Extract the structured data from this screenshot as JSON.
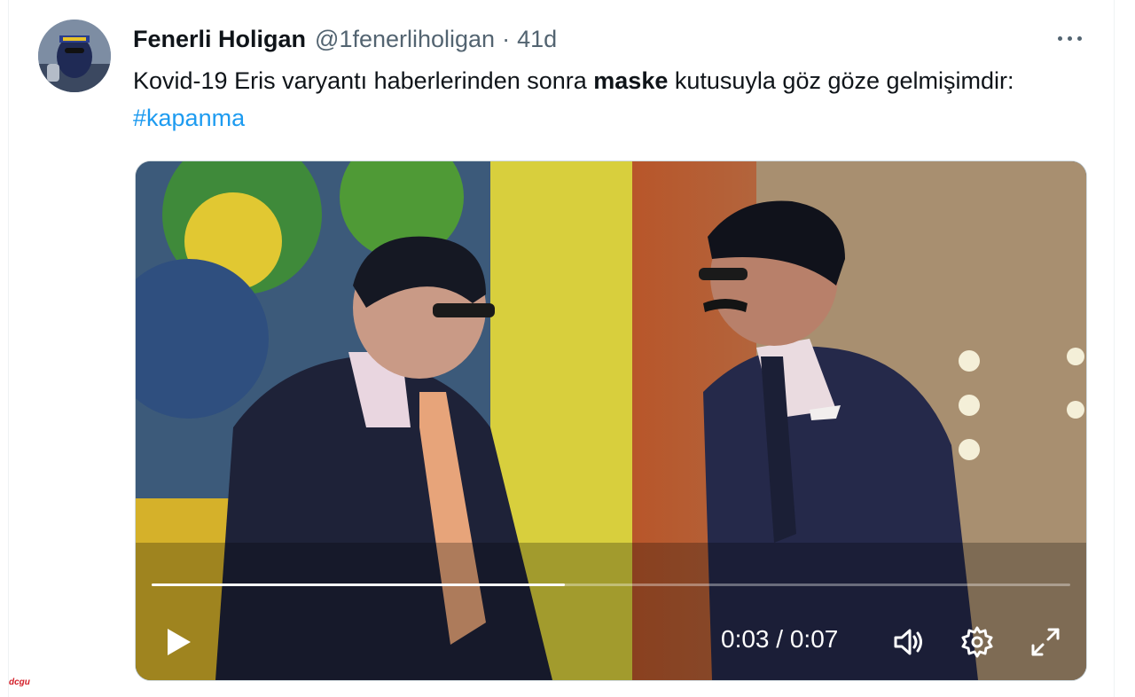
{
  "author": {
    "display_name": "Fenerli Holigan",
    "handle": "@1fenerliholigan",
    "separator": "·",
    "timestamp": "41d"
  },
  "tweet": {
    "text_before": "Kovid-19 Eris varyantı haberlerinden sonra ",
    "bold_word": "maske",
    "text_after": " kutusuyla göz göze gelmişimdir: ",
    "hashtag": "#kapanma"
  },
  "video": {
    "current_time": "0:03",
    "time_separator": "/",
    "duration": "0:07",
    "progress_fraction": 0.45
  },
  "icons": {
    "more": "more-horizontal-icon",
    "play": "play-icon",
    "volume": "volume-icon",
    "settings": "gear-icon",
    "fullscreen": "expand-icon"
  },
  "colors": {
    "hashtag": "#1d9bf0",
    "secondary_text": "#536471",
    "watermark": "#d3202a"
  },
  "watermark": "dcgu"
}
